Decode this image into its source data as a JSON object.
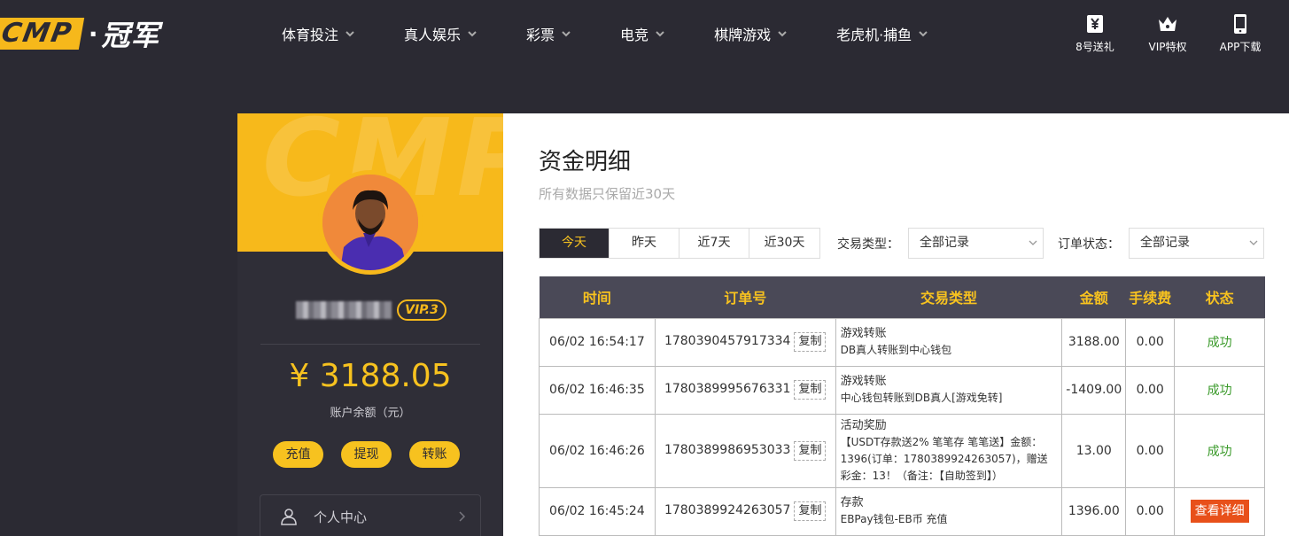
{
  "header": {
    "logo_box": "CMP",
    "logo_dot": "·",
    "logo_text": "冠军",
    "nav": [
      {
        "label": "体育投注"
      },
      {
        "label": "真人娱乐"
      },
      {
        "label": "彩票"
      },
      {
        "label": "电竞"
      },
      {
        "label": "棋牌游戏"
      },
      {
        "label": "老虎机·捕鱼"
      }
    ],
    "right": [
      {
        "label": "8号送礼",
        "icon": "yen-gift-icon"
      },
      {
        "label": "VIP特权",
        "icon": "crown-icon"
      },
      {
        "label": "APP下载",
        "icon": "phone-icon"
      }
    ]
  },
  "profile": {
    "watermark": "CMP",
    "vip": "VIP.3",
    "balance": "¥ 3188.05",
    "balance_label": "账户余额（元）",
    "actions": [
      "充值",
      "提现",
      "转账"
    ],
    "menu_label": "个人中心"
  },
  "main": {
    "title": "资金明细",
    "subtitle": "所有数据只保留近30天",
    "date_tabs": [
      "今天",
      "昨天",
      "近7天",
      "近30天"
    ],
    "active_tab": "今天",
    "filter_type_label": "交易类型：",
    "filter_type_value": "全部记录",
    "filter_status_label": "订单状态：",
    "filter_status_value": "全部记录",
    "copy_label": "复制",
    "columns": [
      "时间",
      "订单号",
      "交易类型",
      "金额",
      "手续费",
      "状态"
    ],
    "rows": [
      {
        "time": "06/02 16:54:17",
        "order": "1780390457917334",
        "type": "游戏转账",
        "desc": "DB真人转账到中心钱包",
        "amount": "3188.00",
        "fee": "0.00",
        "status": "成功"
      },
      {
        "time": "06/02 16:46:35",
        "order": "1780389995676331",
        "type": "游戏转账",
        "desc": "中心钱包转账到DB真人[游戏免转]",
        "amount": "-1409.00",
        "fee": "0.00",
        "status": "成功"
      },
      {
        "time": "06/02 16:46:26",
        "order": "1780389986953033",
        "type": "活动奖励",
        "desc": "【USDT存款送2% 笔笔存 笔笔送】金额：1396(订单：1780389924263057)，赠送彩金：13！（备注：【自助签到】）",
        "amount": "13.00",
        "fee": "0.00",
        "status": "成功"
      },
      {
        "time": "06/02 16:45:24",
        "order": "1780389924263057",
        "type": "存款",
        "desc": "EBPay钱包-EB币 充值",
        "amount": "1396.00",
        "fee": "0.00",
        "status": "查看详细"
      }
    ]
  },
  "colors": {
    "accent": "#f7c21f",
    "dark": "#2b2a33",
    "success": "#3a9a2a",
    "detail": "#e8501a"
  }
}
